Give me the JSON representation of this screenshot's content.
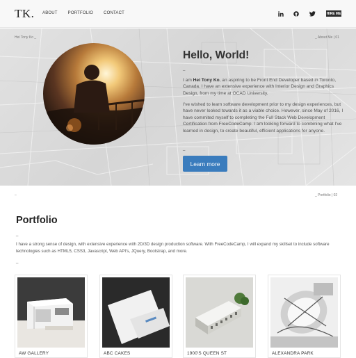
{
  "nav": {
    "brand": "TK.",
    "menu": [
      "ABOUT",
      "PORTFOLIO",
      "CONTACT"
    ],
    "social_icons": [
      "linkedin-icon",
      "github-icon",
      "twitter-icon"
    ],
    "hire_label": "HIRE ME"
  },
  "hero": {
    "crumb_left": "Hei Tony Ko _",
    "crumb_right": "_ About Me | 01",
    "title": "Hello, World!",
    "dash": "_",
    "intro_prefix": "I am ",
    "intro_name": "Hei Tony Ko",
    "intro_rest": ", an aspiring to be Front End Developer based in Toronto, Canada. I have an extensive experience with Interior Design and Graphics Design, from my time at OCAD University.",
    "para2": "I've wished to learn software development prior to my design experiences, but have never looked towards it as a viable choice. However, since May of 2016, I have commited myself to completing the Full Stack Web Development Certification from FreeCodeCamp. I am looking forward to combining what I've learned in design, to create beautiful, efficient applications for anyone.",
    "button": "Learn more"
  },
  "portfolio": {
    "crumb_left": "_",
    "crumb_right": "_ Portfolio | 02",
    "title": "Portfolio",
    "dash": "_",
    "description": "I have a strong sense of design, with extensive experience with 2D/3D design production software. With FreeCodeCamp, I will expand my skillset to include software technologies such as HTML5, CSS3, Javascript, Web API's, JQuery, Bootstrap, and more.",
    "items": [
      {
        "caption": "AW GALLERY"
      },
      {
        "caption": "ABC CAKES"
      },
      {
        "caption": "1900'S QUEEN ST"
      },
      {
        "caption": "ALEXANDRA PARK"
      }
    ]
  },
  "colors": {
    "accent": "#3a7cbd",
    "nav_bg": "#f8f8f8",
    "hire_bg": "#2d2d2d"
  }
}
